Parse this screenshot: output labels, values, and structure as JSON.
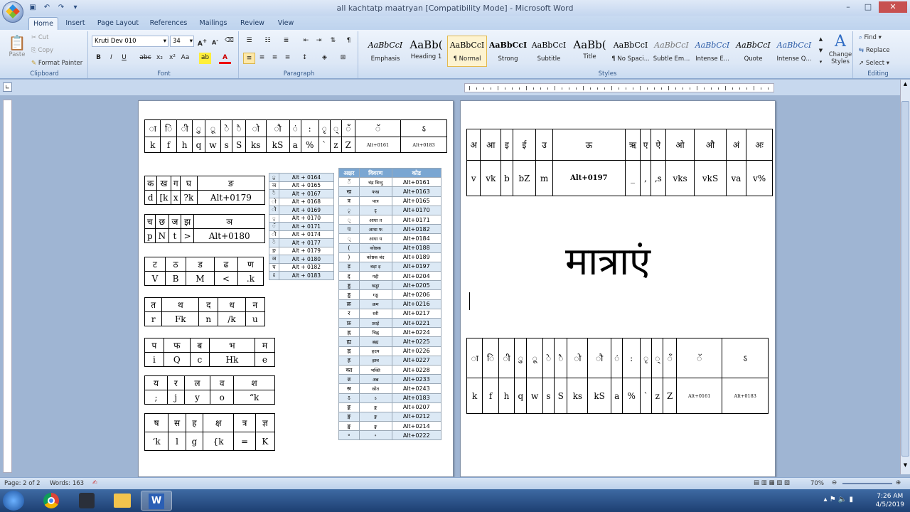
{
  "window": {
    "title": "all kachtatp maatryan [Compatibility Mode] - Microsoft Word"
  },
  "tabs": [
    "Home",
    "Insert",
    "Page Layout",
    "References",
    "Mailings",
    "Review",
    "View"
  ],
  "ribbon": {
    "clipboard": {
      "label": "Clipboard",
      "paste": "Paste",
      "cut": "Cut",
      "copy": "Copy",
      "format_painter": "Format Painter"
    },
    "font": {
      "label": "Font",
      "font_name": "Kruti Dev 010",
      "font_size": "34"
    },
    "paragraph": {
      "label": "Paragraph"
    },
    "styles": {
      "label": "Styles",
      "items": [
        {
          "sample": "AaBbCcI",
          "name": "Emphasis"
        },
        {
          "sample": "AaBb(",
          "name": "Heading 1"
        },
        {
          "sample": "AaBbCcI",
          "name": "¶ Normal"
        },
        {
          "sample": "AaBbCcI",
          "name": "Strong"
        },
        {
          "sample": "AaBbCcI",
          "name": "Subtitle"
        },
        {
          "sample": "AaBb(",
          "name": "Title"
        },
        {
          "sample": "AaBbCcI",
          "name": "¶ No Spaci..."
        },
        {
          "sample": "AaBbCcI",
          "name": "Subtle Em..."
        },
        {
          "sample": "AaBbCcI",
          "name": "Intense E..."
        },
        {
          "sample": "AaBbCcI",
          "name": "Quote"
        },
        {
          "sample": "AaBbCcI",
          "name": "Intense Q..."
        }
      ],
      "change_styles": "Change Styles"
    },
    "editing": {
      "label": "Editing",
      "find": "Find",
      "replace": "Replace",
      "select": "Select"
    }
  },
  "page1": {
    "matra_table": {
      "top": [
        "ा",
        "ि",
        "ी",
        "ु",
        "ू",
        "े",
        "ै",
        "ो",
        "ौ",
        "ं",
        ":",
        "ृ",
        "्",
        "ँ",
        "ॅ",
        "ऽ"
      ],
      "bottom": [
        "k",
        "f",
        "h",
        "q",
        "w",
        "s",
        "S",
        "ks",
        "kS",
        "a",
        "%",
        "`",
        "z",
        "Z",
        "Alt+0161",
        "Alt+0183"
      ]
    },
    "consonant_tables": [
      {
        "top": [
          "क",
          "ख",
          "ग",
          "घ",
          "ङ"
        ],
        "bottom": [
          "d",
          "[k",
          "x",
          "?k",
          "Alt+0179"
        ]
      },
      {
        "top": [
          "च",
          "छ",
          "ज",
          "झ",
          "ञ"
        ],
        "bottom": [
          "p",
          "N",
          "t",
          ">",
          "Alt+0180"
        ]
      },
      {
        "top": [
          "ट",
          "ठ",
          "ड",
          "ढ",
          "ण"
        ],
        "bottom": [
          "V",
          "B",
          "M",
          "<",
          ".k"
        ]
      },
      {
        "top": [
          "त",
          "थ",
          "द",
          "ध",
          "न"
        ],
        "bottom": [
          "r",
          "Fk",
          "n",
          "/k",
          "u"
        ]
      },
      {
        "top": [
          "प",
          "फ",
          "ब",
          "भ",
          "म"
        ],
        "bottom": [
          "i",
          "Q",
          "c",
          "Hk",
          "e"
        ]
      },
      {
        "top": [
          "य",
          "र",
          "ल",
          "व",
          "श"
        ],
        "bottom": [
          ";",
          "j",
          "y",
          "o",
          "“k"
        ]
      },
      {
        "top": [
          "ष",
          "स",
          "ह",
          "क्ष",
          "त्र",
          "ज्ञ"
        ],
        "bottom": [
          "‘k",
          "l",
          "g",
          "{k",
          "=",
          "K"
        ]
      }
    ],
    "alt_table": [
      [
        "ु",
        "Alt + 0164"
      ],
      [
        "ञ",
        "Alt + 0165"
      ],
      [
        "ै",
        "Alt + 0167"
      ],
      [
        "ो",
        "Alt + 0168"
      ],
      [
        "ौ",
        "Alt + 0169"
      ],
      [
        "ृ",
        "Alt + 0170"
      ],
      [
        "ॅ",
        "Alt + 0171"
      ],
      [
        "ी",
        "Alt + 0174"
      ],
      [
        "े",
        "Alt + 0177"
      ],
      [
        "ङ",
        "Alt + 0179"
      ],
      [
        "ञ",
        "Alt + 0180"
      ],
      [
        "प",
        "Alt + 0182"
      ],
      [
        "ऽ",
        "Alt + 0183"
      ]
    ],
    "code_table": {
      "headers": [
        "अक्षर",
        "विवरण",
        "कोड"
      ],
      "rows": [
        [
          "ँ",
          "चंद्र बिन्दु",
          "Alt+0161"
        ],
        [
          "ख",
          "फख",
          "Alt+0163"
        ],
        [
          "त्र",
          "पात्र",
          "Alt+0165"
        ],
        [
          "ृ",
          "टृ",
          "Alt+0170"
        ],
        [
          "्",
          "आधा त",
          "Alt+0171"
        ],
        [
          "प",
          "आधा फ",
          "Alt+0182"
        ],
        [
          "्",
          "आधा य",
          "Alt+0184"
        ],
        [
          "(",
          "कोष्ठक",
          "Alt+0188"
        ],
        [
          ")",
          "कोष्ठक बंद",
          "Alt+0189"
        ],
        [
          "ड़",
          "बड़ा ड़",
          "Alt+0197"
        ],
        [
          "द्द",
          "गद्दी",
          "Alt+0204"
        ],
        [
          "ड्ड",
          "खड्डा",
          "Alt+0205"
        ],
        [
          "ड्ढ",
          "गड्ढ",
          "Alt+0206"
        ],
        [
          "क्र",
          "क्रम",
          "Alt+0216"
        ],
        [
          "र",
          "स्ती",
          "Alt+0217"
        ],
        [
          "फ्र",
          "फ्राई",
          "Alt+0221"
        ],
        [
          "ह्न",
          "चिह्न",
          "Alt+0224"
        ],
        [
          "ह्म",
          "ब्रह्म",
          "Alt+0225"
        ],
        [
          "ह्न",
          "हृदय",
          "Alt+0226"
        ],
        [
          "ह्र",
          "ह्रस्व",
          "Alt+0227"
        ],
        [
          "क्त",
          "भक्ति",
          "Alt+0228"
        ],
        [
          "न्न",
          "अन्न",
          "Alt+0233"
        ],
        [
          "स्र",
          "स्रोत",
          "Alt+0243"
        ],
        [
          "ऽ",
          "ऽ",
          "Alt+0183"
        ],
        [
          "ङ्क",
          "ङ्क",
          "Alt+0207"
        ],
        [
          "ङ्ग",
          "ङ्ग",
          "Alt+0212"
        ],
        [
          "ङ्घ",
          "ङ्घ",
          "Alt+0214"
        ],
        [
          "॰",
          "॰",
          "Alt+0222"
        ]
      ]
    }
  },
  "page2": {
    "vowel_table": {
      "top": [
        "अ",
        "आ",
        "इ",
        "ई",
        "उ",
        "ऊ",
        "ऋ",
        "ए",
        "ऐ",
        "ओ",
        "औ",
        "अं",
        "अः"
      ],
      "bottom": [
        "v",
        "vk",
        "b",
        "bZ",
        "m",
        "Alt+0197",
        "_",
        ",",
        ",s",
        "vks",
        "vkS",
        "va",
        "v%"
      ]
    },
    "heading": "मात्राएं",
    "matra_table": {
      "top": [
        "ा",
        "ि",
        "ी",
        "ु",
        "ू",
        "े",
        "ै",
        "ो",
        "ौ",
        "ं",
        ":",
        "ृ",
        "्",
        "ँ",
        "ॅ",
        "ऽ"
      ],
      "bottom": [
        "k",
        "f",
        "h",
        "q",
        "w",
        "s",
        "S",
        "ks",
        "kS",
        "a",
        "%",
        "`",
        "z",
        "Z",
        "Alt+0161",
        "Alt+0183"
      ]
    }
  },
  "status": {
    "page": "Page: 2 of 2",
    "words": "Words: 163",
    "zoom": "70%"
  },
  "taskbar": {
    "time": "7:26 AM",
    "date": "4/5/2019"
  }
}
